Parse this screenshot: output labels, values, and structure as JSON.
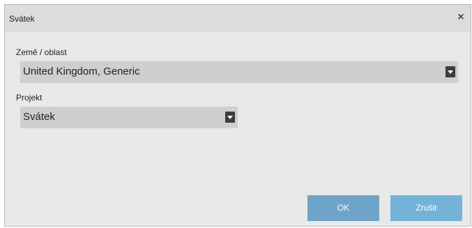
{
  "dialog": {
    "title": "Svátek",
    "close_icon": "close-icon"
  },
  "fields": {
    "country_label": "Země / oblast",
    "country_value": "United Kingdom, Generic",
    "project_label": "Projekt",
    "project_value": "Svátek"
  },
  "buttons": {
    "ok_label": "OK",
    "cancel_label": "Zrušit"
  },
  "colors": {
    "dialog_background": "#e8e8e8",
    "titlebar_background": "#dcdcdc",
    "select_background": "#cfcfcf",
    "select_arrow": "#3d3d3d",
    "ok_button": "#6fa3c9",
    "cancel_button": "#73b3d8",
    "button_text": "#ffffff"
  }
}
